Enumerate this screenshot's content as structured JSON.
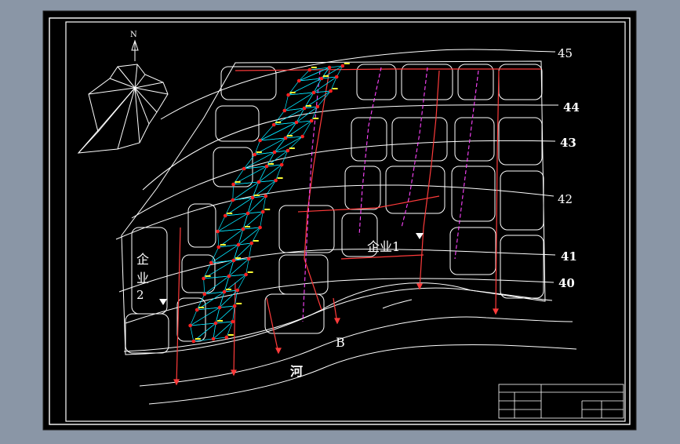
{
  "drawing": {
    "north_label": "N",
    "contours": [
      "45",
      "44",
      "43",
      "42",
      "41",
      "40"
    ],
    "enterprise_1": "企业1",
    "enterprise_2_line1": "企",
    "enterprise_2_line2": "业",
    "enterprise_2_line3": "2",
    "outlet_label": "B",
    "river_label": "河"
  },
  "colors": {
    "background": "#8a96a6",
    "sheet": "#000000",
    "linework": "#ffffff",
    "sewer": "#ff3b3b",
    "dashed_mains": "#ff44ff",
    "triangulation": "#00e5ff",
    "nodes": "#ff2020",
    "node_labels": "#ffff33"
  }
}
